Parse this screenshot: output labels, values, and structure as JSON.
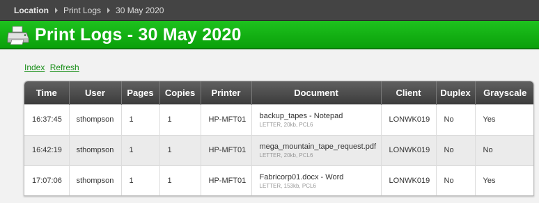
{
  "breadcrumb": {
    "root": "Location",
    "items": [
      "Print Logs",
      "30 May 2020"
    ]
  },
  "page": {
    "title": "Print Logs - 30 May 2020"
  },
  "toolbar": {
    "index_label": "Index",
    "refresh_label": "Refresh"
  },
  "icons": {
    "title_icon": "printer-icon",
    "separator": "triangle-right-icon"
  },
  "colors": {
    "header_green": "#14b014",
    "link_green": "#1a8f1a",
    "breadcrumb_bg": "#444444"
  },
  "table": {
    "columns": [
      "Time",
      "User",
      "Pages",
      "Copies",
      "Printer",
      "Document",
      "Client",
      "Duplex",
      "Grayscale"
    ],
    "rows": [
      {
        "time": "16:37:45",
        "user": "sthompson",
        "pages": "1",
        "copies": "1",
        "printer": "HP-MFT01",
        "document": "backup_tapes - Notepad",
        "doc_meta": "LETTER, 20kb, PCL6",
        "client": "LONWK019",
        "duplex": "No",
        "grayscale": "Yes"
      },
      {
        "time": "16:42:19",
        "user": "sthompson",
        "pages": "1",
        "copies": "1",
        "printer": "HP-MFT01",
        "document": "mega_mountain_tape_request.pdf",
        "doc_meta": "LETTER, 20kb, PCL6",
        "client": "LONWK019",
        "duplex": "No",
        "grayscale": "No"
      },
      {
        "time": "17:07:06",
        "user": "sthompson",
        "pages": "1",
        "copies": "1",
        "printer": "HP-MFT01",
        "document": "Fabricorp01.docx - Word",
        "doc_meta": "LETTER, 153kb, PCL6",
        "client": "LONWK019",
        "duplex": "No",
        "grayscale": "Yes"
      }
    ]
  }
}
